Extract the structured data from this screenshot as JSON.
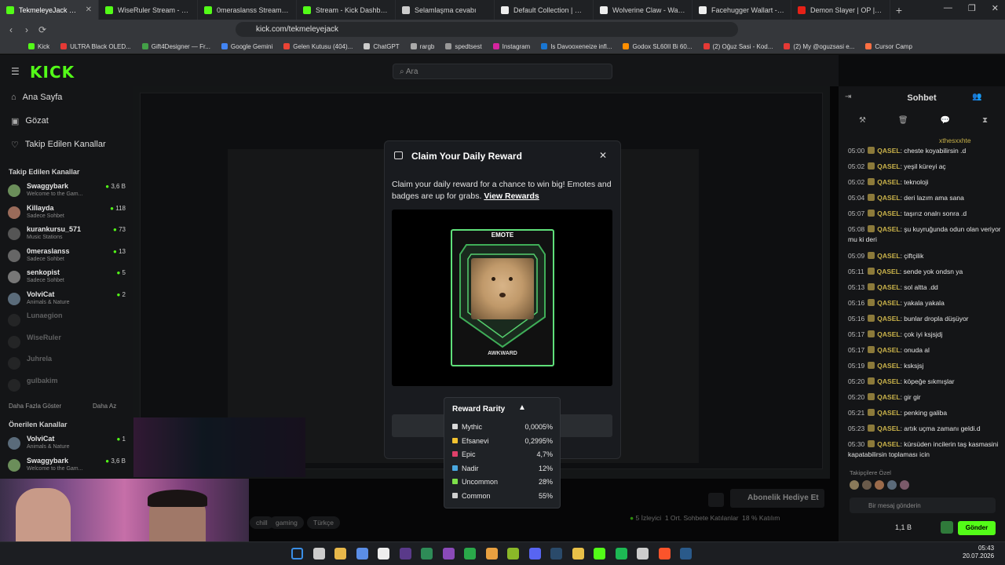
{
  "browser": {
    "tabs": [
      {
        "label": "TekmeleyeJack Stream -",
        "color": "#53fc18",
        "active": true
      },
      {
        "label": "WiseRuler Stream - Watch Li",
        "color": "#53fc18"
      },
      {
        "label": "0meraslanss Stream - Watch",
        "color": "#53fc18"
      },
      {
        "label": "Stream - Kick Dashboard",
        "color": "#53fc18"
      },
      {
        "label": "Selamlaşma cevabı",
        "color": "#cccccc"
      },
      {
        "label": "Default Collection | Collectio",
        "color": "#eeeeee"
      },
      {
        "label": "Wolverine Claw - Wall Mount",
        "color": "#eeeeee"
      },
      {
        "label": "Facehugger Wallart - Free 3D",
        "color": "#eeeeee"
      },
      {
        "label": "Demon Slayer | OP | \"Gureng",
        "color": "#e62117"
      }
    ],
    "url": "kick.com/tekmeleyejack",
    "bookmarks": [
      {
        "label": "Kick",
        "color": "#53fc18"
      },
      {
        "label": "ULTRA Black OLED...",
        "color": "#e53935"
      },
      {
        "label": "Gift4Designer — Fr...",
        "color": "#43a047"
      },
      {
        "label": "Google Gemini",
        "color": "#4285f4"
      },
      {
        "label": "Gelen Kutusu (404)...",
        "color": "#ea4335"
      },
      {
        "label": "ChatGPT",
        "color": "#cccccc"
      },
      {
        "label": "rargb",
        "color": "#aaaaaa"
      },
      {
        "label": "spedtsest",
        "color": "#999999"
      },
      {
        "label": "Instagram",
        "color": "#d6249f"
      },
      {
        "label": "Is Davooxeneize infl...",
        "color": "#1976d2"
      },
      {
        "label": "Godox SL60II Bi 60...",
        "color": "#ff8f00"
      },
      {
        "label": "(2) Oğuz Sasi - Kod...",
        "color": "#e53935"
      },
      {
        "label": "(2) My @oguzsasi e...",
        "color": "#e53935"
      },
      {
        "label": "Cursor Camp",
        "color": "#ff7043"
      }
    ]
  },
  "kick": {
    "logo": "KICK",
    "search_placeholder": "Ara",
    "nav": [
      {
        "label": "Ana Sayfa",
        "icon": "home-icon"
      },
      {
        "label": "Gözat",
        "icon": "browse-icon"
      },
      {
        "label": "Takip Edilen Kanallar",
        "icon": "heart-icon"
      }
    ],
    "followed_header": "Takip Edilen Kanallar",
    "followed": [
      {
        "name": "Swaggybark",
        "category": "Welcome to the Gam...",
        "viewers": "3,6 B",
        "color": "#6b8e5a"
      },
      {
        "name": "Killayda",
        "category": "Sadece Sohbet",
        "viewers": "118",
        "color": "#9a6b5a"
      },
      {
        "name": "kurankursu_571",
        "category": "Music Stations",
        "viewers": "73",
        "color": "#555555"
      },
      {
        "name": "0meraslanss",
        "category": "Sadece Sohbet",
        "viewers": "13",
        "color": "#666666"
      },
      {
        "name": "senkopist",
        "category": "Sadece Sohbet",
        "viewers": "5",
        "color": "#777777"
      },
      {
        "name": "VolviCat",
        "category": "Animals & Nature",
        "viewers": "2",
        "color": "#5a6b7a"
      },
      {
        "name": "Lunaegion",
        "category": "",
        "viewers": "",
        "color": "#444444"
      },
      {
        "name": "WiseRuler",
        "category": "",
        "viewers": "",
        "color": "#444444"
      },
      {
        "name": "Juhrela",
        "category": "",
        "viewers": "",
        "color": "#444444"
      },
      {
        "name": "gulbakim",
        "category": "",
        "viewers": "",
        "color": "#444444"
      }
    ],
    "show_more": "Daha Fazla Göster",
    "show_less": "Daha Az",
    "suggested_header": "Önerilen Kanallar",
    "suggested": [
      {
        "name": "VolviCat",
        "category": "Animals & Nature",
        "viewers": "1",
        "color": "#5a6b7a"
      },
      {
        "name": "Swaggybark",
        "category": "Welcome to the Gam...",
        "viewers": "3,6 B",
        "color": "#6b8e5a"
      }
    ],
    "tags": [
      "chill",
      "gaming",
      "Türkçe"
    ],
    "gift_button": "Abonelik Hediye Et",
    "stats": {
      "viewers": "5 İzleyici",
      "active": "1 Ort. Sohbete Katılanlar",
      "participation": "18 % Katılım"
    }
  },
  "chat": {
    "title": "Sohbet",
    "pinned_user": "xthesxxhte",
    "messages": [
      {
        "time": "05:00",
        "user": "QASEL",
        "text": "cheste koyabilirsin .d"
      },
      {
        "time": "05:02",
        "user": "QASEL",
        "text": "yeşil küreyi aç"
      },
      {
        "time": "05:02",
        "user": "QASEL",
        "text": "teknoloji"
      },
      {
        "time": "05:04",
        "user": "QASEL",
        "text": "deri lazım ama sana"
      },
      {
        "time": "05:07",
        "user": "QASEL",
        "text": "taşırız onalrı sonra .d"
      },
      {
        "time": "05:08",
        "user": "QASEL",
        "text": "şu kuyruğunda odun olan veriyor mu ki deri"
      },
      {
        "time": "05:09",
        "user": "QASEL",
        "text": "çiftçilik"
      },
      {
        "time": "05:11",
        "user": "QASEL",
        "text": "sende yok ondsn ya"
      },
      {
        "time": "05:13",
        "user": "QASEL",
        "text": "sol altta .dd"
      },
      {
        "time": "05:16",
        "user": "QASEL",
        "text": "yakala yakala"
      },
      {
        "time": "05:16",
        "user": "QASEL",
        "text": "bunlar dropla düşüyor"
      },
      {
        "time": "05:17",
        "user": "QASEL",
        "text": "çok iyi ksjsjdj"
      },
      {
        "time": "05:17",
        "user": "QASEL",
        "text": "onuda al"
      },
      {
        "time": "05:19",
        "user": "QASEL",
        "text": "ksksjsj"
      },
      {
        "time": "05:20",
        "user": "QASEL",
        "text": "köpeğe sıkmışlar"
      },
      {
        "time": "05:20",
        "user": "QASEL",
        "text": "gir gir"
      },
      {
        "time": "05:21",
        "user": "QASEL",
        "text": "penking galiba"
      },
      {
        "time": "05:23",
        "user": "QASEL",
        "text": "artık uçma zamanı geldi.d"
      },
      {
        "time": "05:30",
        "user": "QASEL",
        "text": "kürsüden incilerin taş kasmasini kapatabilirsin toplaması icin"
      }
    ],
    "supporters_label": "Takipçilere Özel",
    "input_placeholder": "Bir mesaj gönderin",
    "points": "1,1 B",
    "send_label": "Gönder"
  },
  "modal": {
    "title": "Claim Your Daily Reward",
    "description": "Claim your daily reward for a chance to win big! Emotes and badges are up for grabs.",
    "link": "View Rewards",
    "card_type": "EMOTE",
    "card_name": "AWKWARD"
  },
  "rarity": {
    "title": "Reward Rarity",
    "rows": [
      {
        "label": "Mythic",
        "value": "0,0005%",
        "color": "#d9d9d9"
      },
      {
        "label": "Efsanevi",
        "value": "0,2995%",
        "color": "#f2c230"
      },
      {
        "label": "Epic",
        "value": "4,7%",
        "color": "#e0406a"
      },
      {
        "label": "Nadir",
        "value": "12%",
        "color": "#4aa8e0"
      },
      {
        "label": "Uncommon",
        "value": "28%",
        "color": "#7ee04a"
      },
      {
        "label": "Common",
        "value": "55%",
        "color": "#cfcfcf"
      }
    ]
  },
  "taskbar": {
    "time": "05:43",
    "date": "20.07.2026"
  }
}
